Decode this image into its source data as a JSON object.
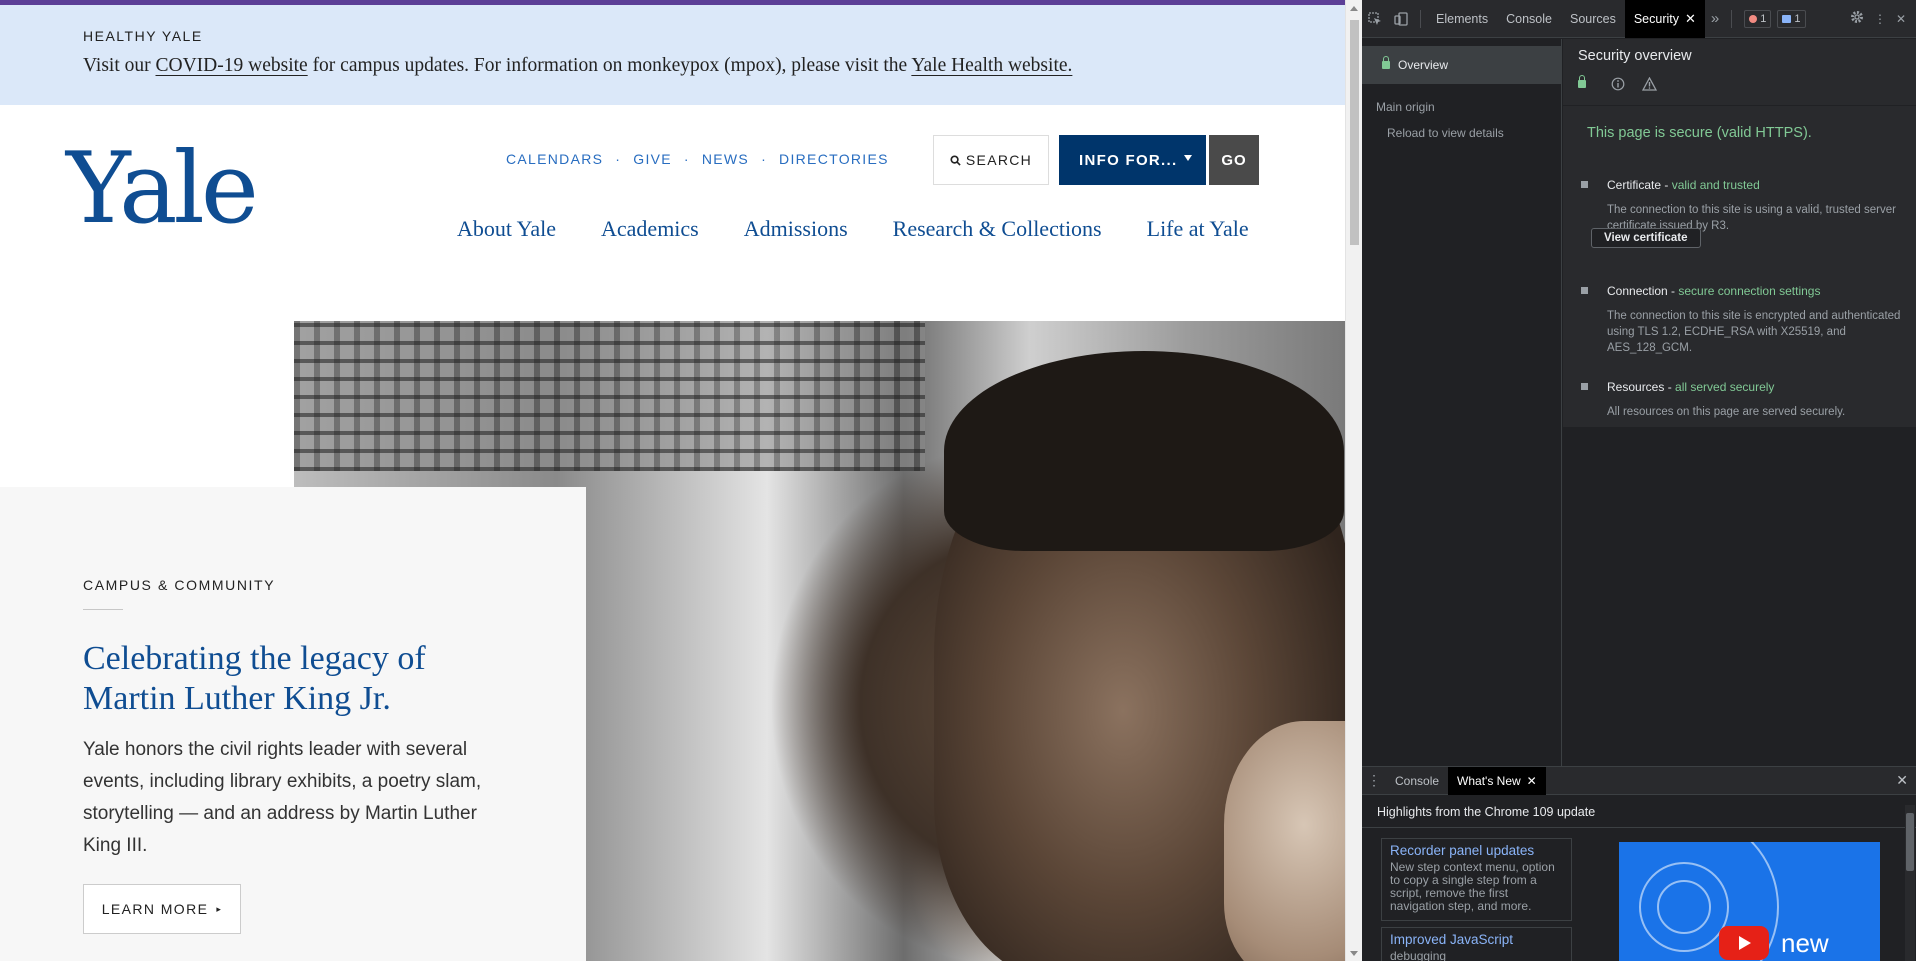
{
  "page": {
    "alert": {
      "kicker": "HEALTHY YALE",
      "text_before": "Visit our ",
      "link1": "COVID-19 website",
      "text_middle": " for campus updates. For information on monkeypox (mpox), please visit the ",
      "link2": "Yale Health website.",
      "text_after": ""
    },
    "logo": "Yale",
    "utility_nav": [
      "CALENDARS",
      "GIVE",
      "NEWS",
      "DIRECTORIES"
    ],
    "utility_separator": "·",
    "search_label": "SEARCH",
    "info_for_label": "INFO FOR...",
    "go_label": "GO",
    "main_nav": [
      "About Yale",
      "Academics",
      "Admissions",
      "Research & Collections",
      "Life at Yale"
    ],
    "feature": {
      "kicker": "CAMPUS & COMMUNITY",
      "title": "Celebrating the legacy of Martin Luther King Jr.",
      "body": "Yale honors the civil rights leader with several events, including library exhibits, a poetry slam, storytelling — and an address by Martin Luther King III.",
      "cta": "LEARN MORE",
      "cta_icon": "triangle-right-icon"
    }
  },
  "devtools": {
    "tabs": [
      "Elements",
      "Console",
      "Sources",
      "Security"
    ],
    "active_tab": "Security",
    "error_count": "1",
    "message_count": "1",
    "sidebar": {
      "overview": "Overview",
      "main_origin": "Main origin",
      "reload": "Reload to view details"
    },
    "security": {
      "title": "Security overview",
      "summary": "This page is secure (valid HTTPS).",
      "certificate": {
        "label": "Certificate - ",
        "status": "valid and trusted",
        "desc": "The connection to this site is using a valid, trusted server certificate issued by R3.",
        "button": "View certificate"
      },
      "connection": {
        "label": "Connection - ",
        "status": "secure connection settings",
        "desc": "The connection to this site is encrypted and authenticated using TLS 1.2, ECDHE_RSA with X25519, and AES_128_GCM."
      },
      "resources": {
        "label": "Resources - ",
        "status": "all served securely",
        "desc": "All resources on this page are served securely."
      }
    },
    "drawer": {
      "tabs": [
        "Console",
        "What's New"
      ],
      "active_tab": "What's New",
      "headline": "Highlights from the Chrome 109 update",
      "cards": [
        {
          "title": "Recorder panel updates",
          "desc": "New step context menu, option to copy a single step from a script, remove the first navigation step, and more."
        },
        {
          "title": "Improved JavaScript",
          "desc": "debugging"
        }
      ],
      "video_text": "new"
    },
    "colors": {
      "secure_green": "#81c995",
      "link_blue": "#8ab4f8",
      "panel_bg": "#202124"
    }
  }
}
